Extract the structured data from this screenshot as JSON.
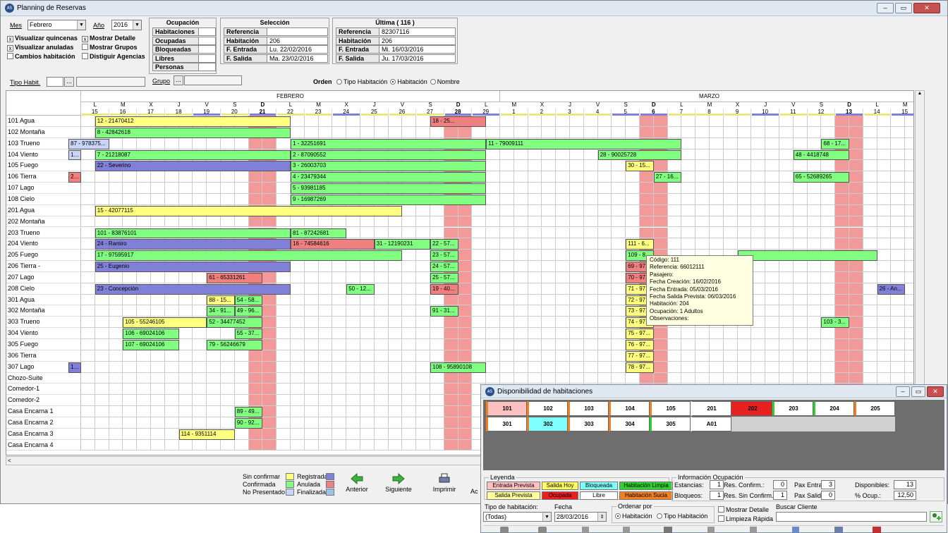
{
  "window": {
    "title": "Planning de Reservas"
  },
  "filters": {
    "mes_label": "Mes",
    "mes": "Febrero",
    "anio_label": "Año",
    "anio": "2016",
    "options": [
      {
        "label": "Visualizar quincenas",
        "checked": true
      },
      {
        "label": "Mostrar Detalle",
        "checked": true
      },
      {
        "label": "Visualizar anuladas",
        "checked": true
      },
      {
        "label": "Mostrar Grupos",
        "checked": false
      },
      {
        "label": "Cambios habitación",
        "checked": false
      },
      {
        "label": "Distiguir Agencias",
        "checked": false
      }
    ],
    "tipo_habit_label": "Tipo Habit.",
    "grupo_label": "Grupo",
    "browse": "..."
  },
  "ocupacion": {
    "title": "Ocupación",
    "rows": [
      "Habitaciones",
      "Ocupadas",
      "Bloqueadas",
      "Libres",
      "Personas"
    ]
  },
  "seleccion": {
    "title": "Selección",
    "rows": [
      {
        "k": "Referencia",
        "v": ""
      },
      {
        "k": "Habitación",
        "v": "206"
      },
      {
        "k": "F. Entrada",
        "v": "Lu. 22/02/2016"
      },
      {
        "k": "F. Salida",
        "v": "Ma. 23/02/2016"
      }
    ]
  },
  "ultima": {
    "title": "Última   ( 116 )",
    "rows": [
      {
        "k": "Referencia",
        "v": "82307116"
      },
      {
        "k": "Habitación",
        "v": "206"
      },
      {
        "k": "F. Entrada",
        "v": "Mi. 16/03/2016"
      },
      {
        "k": "F. Salida",
        "v": "Ju. 17/03/2016"
      }
    ]
  },
  "orden": {
    "label": "Orden",
    "options": [
      "Tipo Habitación",
      "Habitación",
      "Nombre"
    ],
    "selected": 1
  },
  "colors": {
    "yellow": "#ffff80",
    "green": "#80ff80",
    "purple": "#8080d8",
    "red": "#f08080",
    "blue": "#c8d4f8",
    "weekend": "#f29a9a"
  },
  "calendar": {
    "months": [
      {
        "name": "FEBRERO",
        "from": 0,
        "to": 15
      },
      {
        "name": "MARZO",
        "from": 15,
        "to": 30
      }
    ],
    "days": [
      {
        "d": "L",
        "n": "15"
      },
      {
        "d": "M",
        "n": "16"
      },
      {
        "d": "X",
        "n": "17"
      },
      {
        "d": "J",
        "n": "18"
      },
      {
        "d": "V",
        "n": "19"
      },
      {
        "d": "S",
        "n": "20"
      },
      {
        "d": "D",
        "n": "21",
        "w": true
      },
      {
        "d": "L",
        "n": "22"
      },
      {
        "d": "M",
        "n": "23"
      },
      {
        "d": "X",
        "n": "24"
      },
      {
        "d": "J",
        "n": "25"
      },
      {
        "d": "V",
        "n": "26"
      },
      {
        "d": "S",
        "n": "27"
      },
      {
        "d": "D",
        "n": "28",
        "w": true
      },
      {
        "d": "L",
        "n": "29"
      },
      {
        "d": "M",
        "n": "1"
      },
      {
        "d": "X",
        "n": "2"
      },
      {
        "d": "J",
        "n": "3"
      },
      {
        "d": "V",
        "n": "4"
      },
      {
        "d": "S",
        "n": "5"
      },
      {
        "d": "D",
        "n": "6",
        "w": true
      },
      {
        "d": "L",
        "n": "7"
      },
      {
        "d": "M",
        "n": "8"
      },
      {
        "d": "X",
        "n": "9"
      },
      {
        "d": "J",
        "n": "10"
      },
      {
        "d": "V",
        "n": "11"
      },
      {
        "d": "S",
        "n": "12"
      },
      {
        "d": "D",
        "n": "13",
        "w": true
      },
      {
        "d": "L",
        "n": "14"
      },
      {
        "d": "M",
        "n": "15"
      }
    ],
    "rooms": [
      "101 Agua",
      "102 Montaña",
      "103 Trueno",
      "104 Viento",
      "105 Fuego",
      "106 Tierra",
      "107 Lago",
      "108 Cielo",
      "201 Agua",
      "202 Montaña",
      "203 Trueno",
      "204 Viento",
      "205 Fuego",
      "206 Tierra -",
      "207 Lago",
      "208 Cielo",
      "301 Agua",
      "302 Montaña",
      "303 Trueno",
      "304 Viento",
      "305 Fuego",
      "306 Tierra",
      "307 Lago",
      "Chozo-Suite",
      "Comedor-1",
      "Comedor-2",
      "Casa Encarna 1",
      "Casa Encarna 2",
      "Casa Encarna 3",
      "Casa Encarna 4"
    ],
    "bookings": [
      {
        "r": 0,
        "s": 0,
        "e": 7,
        "c": "yellow",
        "t": "12 - 21470412"
      },
      {
        "r": 0,
        "s": 12,
        "e": 14,
        "c": "red",
        "t": "18 - 25..."
      },
      {
        "r": 1,
        "s": 0,
        "e": 7,
        "c": "green",
        "t": "8 - 42842618"
      },
      {
        "r": 2,
        "s": -1,
        "e": 1,
        "c": "blue",
        "t": "87 - 978375..."
      },
      {
        "r": 2,
        "s": 7,
        "e": 14,
        "c": "green",
        "t": "1 - 32251691"
      },
      {
        "r": 2,
        "s": 14,
        "e": 21,
        "c": "green",
        "t": "11 - 79009111"
      },
      {
        "r": 2,
        "s": 26,
        "e": 27,
        "c": "green",
        "t": "68 - 17..."
      },
      {
        "r": 3,
        "s": -1,
        "e": 0,
        "c": "blue",
        "t": "1..."
      },
      {
        "r": 3,
        "s": 0,
        "e": 7,
        "c": "green",
        "t": "7 - 21218087"
      },
      {
        "r": 3,
        "s": 7,
        "e": 14,
        "c": "green",
        "t": "2 - 87090552"
      },
      {
        "r": 3,
        "s": 18,
        "e": 21,
        "c": "green",
        "t": "28 - 90025728"
      },
      {
        "r": 3,
        "s": 25,
        "e": 27,
        "c": "green",
        "t": "48 - 4418748"
      },
      {
        "r": 4,
        "s": 0,
        "e": 7,
        "c": "purple",
        "t": "22 - Severino"
      },
      {
        "r": 4,
        "s": 7,
        "e": 14,
        "c": "green",
        "t": "3 - 26003703"
      },
      {
        "r": 4,
        "s": 19,
        "e": 20,
        "c": "yellow",
        "t": "30 - 15..."
      },
      {
        "r": 5,
        "s": -1,
        "e": 0,
        "c": "red",
        "t": "2..."
      },
      {
        "r": 5,
        "s": 7,
        "e": 14,
        "c": "green",
        "t": "4 - 23479344"
      },
      {
        "r": 5,
        "s": 20,
        "e": 21,
        "c": "green",
        "t": "27 - 16..."
      },
      {
        "r": 5,
        "s": 25,
        "e": 27,
        "c": "green",
        "t": "65 - 52689265"
      },
      {
        "r": 6,
        "s": 7,
        "e": 14,
        "c": "green",
        "t": "5 - 93981185"
      },
      {
        "r": 7,
        "s": 7,
        "e": 14,
        "c": "green",
        "t": "9 - 16987269"
      },
      {
        "r": 8,
        "s": 0,
        "e": 11,
        "c": "yellow",
        "t": "15 - 42077115"
      },
      {
        "r": 10,
        "s": 0,
        "e": 7,
        "c": "green",
        "t": "101 - 83876101"
      },
      {
        "r": 10,
        "s": 7,
        "e": 9,
        "c": "green",
        "t": "81 - 87242681"
      },
      {
        "r": 11,
        "s": 0,
        "e": 7,
        "c": "purple",
        "t": "24 - Ramiro"
      },
      {
        "r": 11,
        "s": 7,
        "e": 10,
        "c": "red",
        "t": "16 - 74584616"
      },
      {
        "r": 11,
        "s": 10,
        "e": 12,
        "c": "green",
        "t": "31 - 12190231"
      },
      {
        "r": 11,
        "s": 12,
        "e": 13,
        "c": "green",
        "t": "22 - 57..."
      },
      {
        "r": 11,
        "s": 19,
        "e": 20,
        "c": "yellow",
        "t": "111 - 6..."
      },
      {
        "r": 12,
        "s": 0,
        "e": 11,
        "c": "green",
        "t": "17 - 97595917"
      },
      {
        "r": 12,
        "s": 12,
        "e": 13,
        "c": "green",
        "t": "23 - 57..."
      },
      {
        "r": 12,
        "s": 19,
        "e": 20,
        "c": "green",
        "t": "109 - 8..."
      },
      {
        "r": 12,
        "s": 23,
        "e": 28,
        "c": "green",
        "t": ""
      },
      {
        "r": 13,
        "s": 0,
        "e": 7,
        "c": "purple",
        "t": "25 - Eugenio"
      },
      {
        "r": 13,
        "s": 12,
        "e": 13,
        "c": "green",
        "t": "24 - 57..."
      },
      {
        "r": 13,
        "s": 19,
        "e": 20,
        "c": "red",
        "t": "69 - 97..."
      },
      {
        "r": 14,
        "s": 4,
        "e": 6,
        "c": "red",
        "t": "61 - 65331261"
      },
      {
        "r": 14,
        "s": 12,
        "e": 13,
        "c": "green",
        "t": "25 - 57..."
      },
      {
        "r": 14,
        "s": 19,
        "e": 20,
        "c": "red",
        "t": "70 - 97..."
      },
      {
        "r": 15,
        "s": 0,
        "e": 7,
        "c": "purple",
        "t": "23 - Concepción"
      },
      {
        "r": 15,
        "s": 9,
        "e": 10,
        "c": "green",
        "t": "50 - 12..."
      },
      {
        "r": 15,
        "s": 12,
        "e": 13,
        "c": "red",
        "t": "19 - 40..."
      },
      {
        "r": 15,
        "s": 19,
        "e": 20,
        "c": "yellow",
        "t": "71 - 97..."
      },
      {
        "r": 15,
        "s": 28,
        "e": 29,
        "c": "purple",
        "t": "26 - An..."
      },
      {
        "r": 16,
        "s": 4,
        "e": 5,
        "c": "yellow",
        "t": "88 - 15..."
      },
      {
        "r": 16,
        "s": 5,
        "e": 6,
        "c": "green",
        "t": "54 - 58..."
      },
      {
        "r": 16,
        "s": 19,
        "e": 20,
        "c": "yellow",
        "t": "72 - 97..."
      },
      {
        "r": 17,
        "s": 4,
        "e": 5,
        "c": "green",
        "t": "34 - 91..."
      },
      {
        "r": 17,
        "s": 5,
        "e": 6,
        "c": "green",
        "t": "49 - 96..."
      },
      {
        "r": 17,
        "s": 12,
        "e": 13,
        "c": "green",
        "t": "91 - 31..."
      },
      {
        "r": 17,
        "s": 19,
        "e": 20,
        "c": "yellow",
        "t": "73 - 97..."
      },
      {
        "r": 18,
        "s": 1,
        "e": 4,
        "c": "yellow",
        "t": "105 - 55246105"
      },
      {
        "r": 18,
        "s": 4,
        "e": 6,
        "c": "green",
        "t": "52 - 34477452"
      },
      {
        "r": 18,
        "s": 19,
        "e": 20,
        "c": "yellow",
        "t": "74 - 97..."
      },
      {
        "r": 18,
        "s": 26,
        "e": 27,
        "c": "green",
        "t": "103 - 3..."
      },
      {
        "r": 19,
        "s": 1,
        "e": 3,
        "c": "green",
        "t": "106 - 69024106"
      },
      {
        "r": 19,
        "s": 5,
        "e": 6,
        "c": "green",
        "t": "55 - 37..."
      },
      {
        "r": 19,
        "s": 19,
        "e": 20,
        "c": "yellow",
        "t": "75 - 97..."
      },
      {
        "r": 20,
        "s": 1,
        "e": 3,
        "c": "green",
        "t": "107 - 69024106"
      },
      {
        "r": 20,
        "s": 4,
        "e": 6,
        "c": "green",
        "t": "79 - 56246679"
      },
      {
        "r": 20,
        "s": 19,
        "e": 20,
        "c": "yellow",
        "t": "76 - 97..."
      },
      {
        "r": 21,
        "s": 19,
        "e": 20,
        "c": "yellow",
        "t": "77 - 97..."
      },
      {
        "r": 22,
        "s": -1,
        "e": 0,
        "c": "purple",
        "t": "1..."
      },
      {
        "r": 22,
        "s": 12,
        "e": 14,
        "c": "green",
        "t": "108 - 95890108"
      },
      {
        "r": 22,
        "s": 19,
        "e": 20,
        "c": "yellow",
        "t": "78 - 97..."
      },
      {
        "r": 26,
        "s": 5,
        "e": 6,
        "c": "green",
        "t": "89 - 49..."
      },
      {
        "r": 27,
        "s": 5,
        "e": 6,
        "c": "green",
        "t": "90 - 92..."
      },
      {
        "r": 28,
        "s": 3,
        "e": 5,
        "c": "yellow",
        "t": "114 - 9351114"
      }
    ]
  },
  "tooltip": [
    "Código: 111",
    "Referencia: 66012111",
    "Pasajero:",
    "Fecha Creación: 16/02/2016",
    "Fecha Entrada: 05/03/2016",
    "Fecha Salida Prevista: 06/03/2016",
    "Habitación: 204",
    "Ocupación: 1 Adultos",
    "Observaciones:"
  ],
  "legend": [
    "Sin confirmar",
    "Confirmada",
    "No Presentado",
    "Registrada",
    "Anulada",
    "Finalizada"
  ],
  "nav": {
    "anterior": "Anterior",
    "siguiente": "Siguiente",
    "imprimir": "Imprimir",
    "ac": "Ac"
  },
  "disp": {
    "title": "Disponibilidad de habitaciones",
    "rooms": [
      {
        "n": "101",
        "bg": "#ffc0c0",
        "lb": "#f08020"
      },
      {
        "n": "102",
        "bg": "#ffffff",
        "lb": "#f08020"
      },
      {
        "n": "103",
        "bg": "#ffffff",
        "lb": "#f08020"
      },
      {
        "n": "104",
        "bg": "#ffffff",
        "lb": "#f08020"
      },
      {
        "n": "105",
        "bg": "#ffffff",
        "lb": "#f08020"
      },
      {
        "n": "201",
        "bg": "#ffffff",
        "lb": "#ffffff"
      },
      {
        "n": "202",
        "bg": "#e82020",
        "lb": "#e82020"
      },
      {
        "n": "203",
        "bg": "#ffffff",
        "lb": "#30d030"
      },
      {
        "n": "204",
        "bg": "#ffffff",
        "lb": "#30d030"
      },
      {
        "n": "205",
        "bg": "#ffffff",
        "lb": "#f08020"
      },
      {
        "n": "301",
        "bg": "#ffffff",
        "lb": "#f08020"
      },
      {
        "n": "302",
        "bg": "#80ffff",
        "lb": "#f08020"
      },
      {
        "n": "303",
        "bg": "#ffffff",
        "lb": "#f08020"
      },
      {
        "n": "304",
        "bg": "#ffffff",
        "lb": "#f08020"
      },
      {
        "n": "305",
        "bg": "#ffffff",
        "lb": "#30d030"
      },
      {
        "n": "A01",
        "bg": "#ffffff",
        "lb": "#ffffff"
      }
    ],
    "leyenda_title": "Leyenda",
    "leyenda": [
      {
        "t": "Entrada Prevista",
        "bg": "#ffc0c0"
      },
      {
        "t": "Salida Hoy",
        "bg": "#ffff60"
      },
      {
        "t": "Bloqueada",
        "bg": "#80ffff"
      },
      {
        "t": "Habitación Limpia",
        "bg": "#30d030"
      },
      {
        "t": "Salida Prevista",
        "bg": "#ffffa0"
      },
      {
        "t": "Ocupada",
        "bg": "#e82020"
      },
      {
        "t": "Libre",
        "bg": "#ffffff"
      },
      {
        "t": "Habitación Sucia",
        "bg": "#f08020"
      }
    ],
    "info_title": "Información Ocupación",
    "info": [
      {
        "k": "Estancias:",
        "v": "1"
      },
      {
        "k": "Res. Confirm.:",
        "v": "0"
      },
      {
        "k": "Pax Entrada:",
        "v": "3"
      },
      {
        "k": "Disponibles:",
        "v": "13"
      },
      {
        "k": "Bloqueos:",
        "v": "1"
      },
      {
        "k": "Res. Sin Confirm.:",
        "v": "1"
      },
      {
        "k": "Pax Salida:",
        "v": "0"
      },
      {
        "k": "% Ocup.:",
        "v": "12,50"
      }
    ],
    "tipo_label": "Tipo de habitación:",
    "tipo_value": "(Todas)",
    "fecha_label": "Fecha",
    "fecha_value": "28/03/2016",
    "ordenar_label": "Ordenar por",
    "ordenar": [
      "Habitación",
      "Tipo Habitación"
    ],
    "mostrar_detalle": "Mostrar Detalle",
    "limpieza": "Limpieza Rápida",
    "buscar_label": "Buscar Cliente"
  }
}
